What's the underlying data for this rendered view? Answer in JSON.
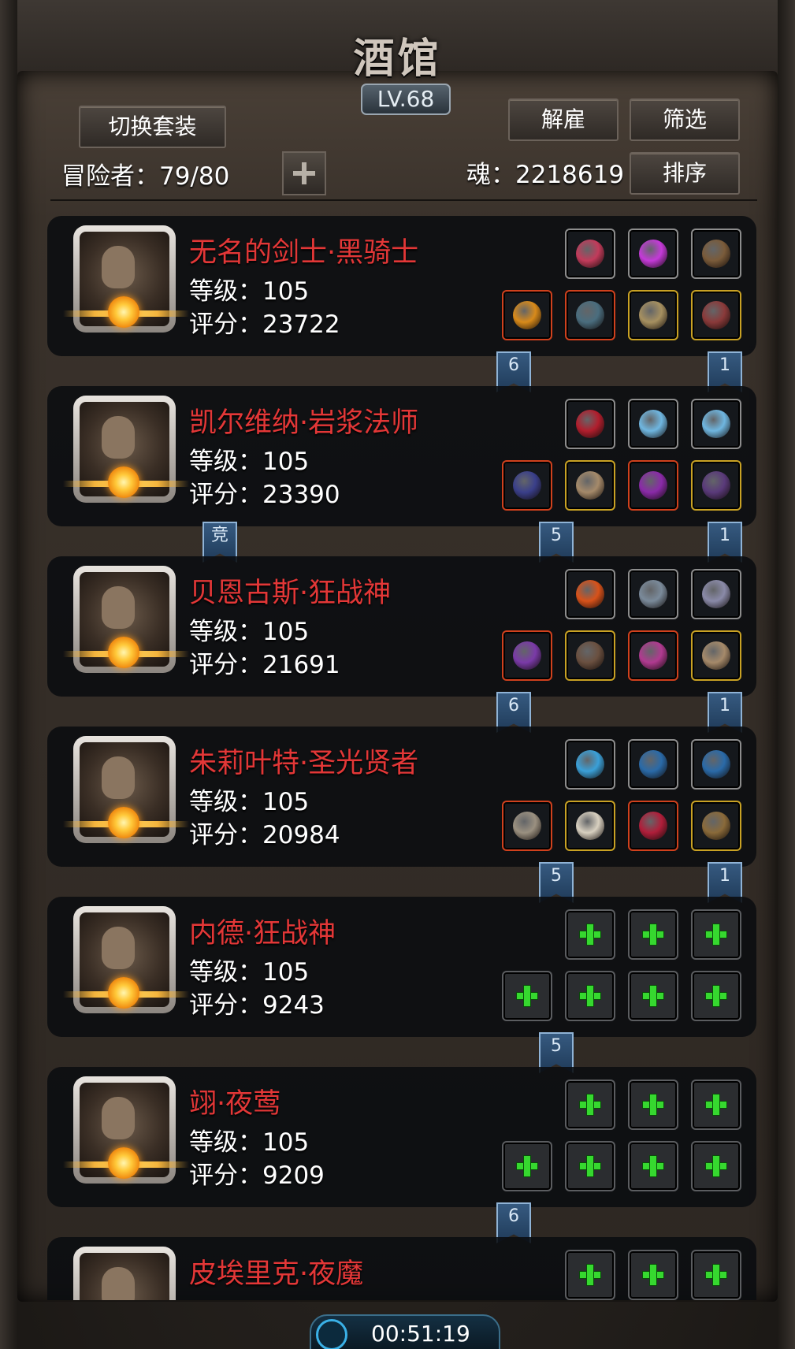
{
  "header": {
    "title": "酒馆",
    "level": "LV.68",
    "switch_outfit_label": "切换套装",
    "dismiss_label": "解雇",
    "filter_label": "筛选",
    "sort_label": "排序",
    "adventurers_label": "冒险者：79/80",
    "soul_label": "魂：2218619"
  },
  "heroes": [
    {
      "name": "无名的剑士·黑骑士",
      "level": "等级：105",
      "score": "评分：23722",
      "flags": [
        "6",
        "1"
      ]
    },
    {
      "name": "凯尔维纳·岩浆法师",
      "level": "等级：105",
      "score": "评分：23390",
      "flags": [
        "竞",
        "5",
        "1"
      ]
    },
    {
      "name": "贝恩古斯·狂战神",
      "level": "等级：105",
      "score": "评分：21691",
      "flags": [
        "6",
        "1"
      ]
    },
    {
      "name": "朱莉叶特·圣光贤者",
      "level": "等级：105",
      "score": "评分：20984",
      "flags": [
        "5",
        "1"
      ]
    },
    {
      "name": "内德·狂战神",
      "level": "等级：105",
      "score": "评分：9243",
      "flags": [
        "5"
      ]
    },
    {
      "name": "翊·夜莺",
      "level": "等级：105",
      "score": "评分：9209",
      "flags": [
        "6"
      ]
    },
    {
      "name": "皮埃里克·夜魔",
      "level": "",
      "score": "",
      "flags": []
    }
  ],
  "timer": "00:51:19",
  "colors": {
    "hero_name": "#e33737",
    "plus_green": "#36d82f",
    "flag_blue": "#365a80",
    "slot_red": "#d0411d",
    "slot_gold": "#c9a224"
  },
  "icons": {
    "add": "plus-icon",
    "star_badge": "sun-badge-icon",
    "timer": "clock-icon"
  }
}
